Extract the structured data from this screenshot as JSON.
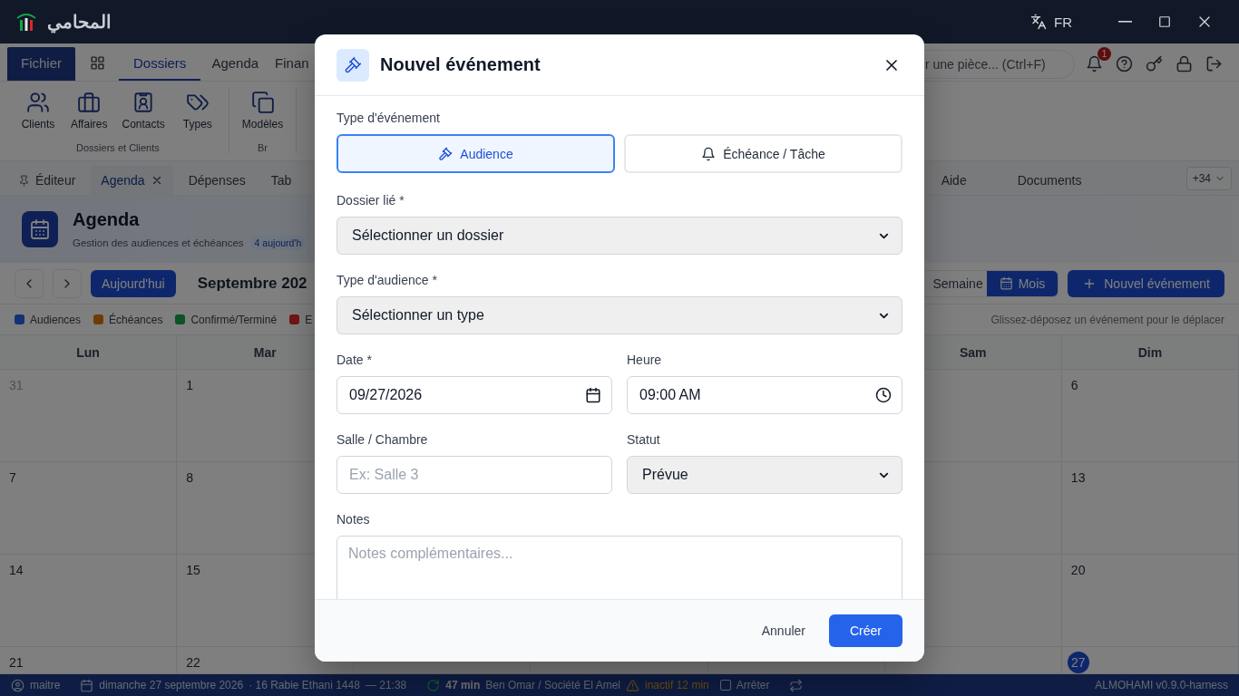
{
  "window": {
    "app_name": "المحامي",
    "language": "FR"
  },
  "ribbon": {
    "tabs": [
      {
        "kind": "file",
        "label": "Fichier",
        "selected": false
      },
      {
        "kind": "apps",
        "selected": false
      },
      {
        "kind": "text",
        "label": "Dossiers",
        "selected": true
      },
      {
        "kind": "text",
        "label": "Agenda",
        "selected": false
      },
      {
        "kind": "text",
        "label": "Finan",
        "selected": false
      }
    ],
    "search": {
      "placeholder": "r une pièce... (Ctrl+F)"
    },
    "notifications": {
      "count": "1"
    },
    "groups": [
      {
        "label": "Dossiers et Clients",
        "items": [
          "Clients",
          "Affaires",
          "Contacts",
          "Types"
        ]
      },
      {
        "label": "Br",
        "items": [
          "Modèles"
        ]
      }
    ]
  },
  "doc_tabs": {
    "tabs": [
      {
        "label": "Éditeur",
        "pinned": true,
        "closable": false,
        "selected": false
      },
      {
        "label": "Agenda",
        "pinned": false,
        "closable": true,
        "selected": true
      },
      {
        "label": "Dépenses",
        "pinned": false,
        "closable": false,
        "selected": false
      },
      {
        "label": "Tab",
        "pinned": false,
        "closable": false,
        "selected": false
      }
    ],
    "right_tabs": [
      "Aide",
      "Documents"
    ],
    "overflow": "+34"
  },
  "agenda": {
    "title": "Agenda",
    "subtitle": "Gestion des audiences et échéances",
    "today_badge": "4 aujourd'h",
    "today_button": "Aujourd'hui",
    "month": "Septembre 202",
    "views": [
      {
        "label": "Semaine",
        "selected": false
      },
      {
        "label": "Mois",
        "selected": true
      }
    ],
    "new_button": "Nouvel événement",
    "legend": [
      {
        "label": "Audiences",
        "color": "#133276"
      },
      {
        "label": "Échéances",
        "color": "#6d3c04"
      },
      {
        "label": "Confirmé/Terminé",
        "color": "#0b5226"
      },
      {
        "label": "E",
        "color": "#6e1414"
      }
    ],
    "hint": "Glissez-déposez un événement pour le déplacer",
    "weekdays": [
      "Lun",
      "Mar",
      "Sam",
      "Dim"
    ],
    "weeks": [
      [
        {
          "day": "31",
          "other_month": true,
          "today": false
        },
        {
          "day": "1",
          "other_month": false,
          "today": false
        },
        {
          "day": "6",
          "other_month": false,
          "today": false
        }
      ],
      [
        {
          "day": "7",
          "other_month": false,
          "today": false
        },
        {
          "day": "8",
          "other_month": false,
          "today": false
        },
        {
          "day": "13",
          "other_month": false,
          "today": false
        }
      ],
      [
        {
          "day": "14",
          "other_month": false,
          "today": false
        },
        {
          "day": "15",
          "other_month": false,
          "today": false
        },
        {
          "day": "20",
          "other_month": false,
          "today": false
        }
      ],
      [
        {
          "day": "21",
          "other_month": false,
          "today": false
        },
        {
          "day": "22",
          "other_month": false,
          "today": false
        },
        {
          "day": "27",
          "other_month": false,
          "today": true
        }
      ]
    ]
  },
  "status_bar": {
    "user": "maitre",
    "date": "dimanche 27 septembre 2026",
    "hijri": "· 16 Rabie Ethani 1448",
    "time": "— 21:38",
    "timer": "47 min",
    "client": "Ben Omar / Société El Amel",
    "idle": "inactif 12 min",
    "stop": {
      "label": "Arrêter",
      "checked": false
    },
    "version": "ALMOHAMI v0.9.0-harness"
  },
  "dialog": {
    "title": "Nouvel événement",
    "type_label": "Type d'événement",
    "types": [
      {
        "kind": "hearing",
        "label": "Audience",
        "selected": true
      },
      {
        "kind": "deadline",
        "label": "Échéance / Tâche",
        "selected": false
      }
    ],
    "rows": [
      [
        {
          "kind": "select",
          "label": "Dossier lié *",
          "value": "Sélectionner un dossier"
        }
      ],
      [
        {
          "kind": "select",
          "label": "Type d'audience *",
          "value": "Sélectionner un type"
        }
      ],
      [
        {
          "kind": "date",
          "label": "Date *",
          "value": "09/27/2026"
        },
        {
          "kind": "time",
          "label": "Heure",
          "value": "09:00 AM"
        }
      ],
      [
        {
          "kind": "text",
          "label": "Salle / Chambre",
          "placeholder": "Ex: Salle 3"
        },
        {
          "kind": "select",
          "label": "Statut",
          "value": "Prévue"
        }
      ],
      [
        {
          "kind": "textarea",
          "label": "Notes",
          "placeholder": "Notes complémentaires..."
        }
      ]
    ],
    "cancel": "Annuler",
    "submit": "Créer"
  }
}
